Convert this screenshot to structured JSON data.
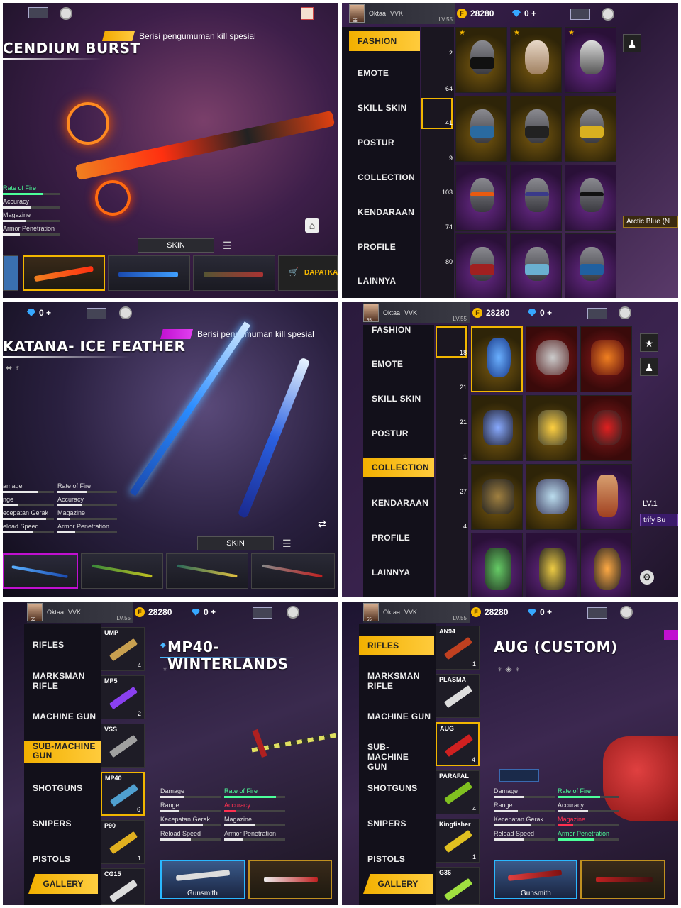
{
  "profile": {
    "name": "Oktaa",
    "guild": "VVK",
    "level": "LV.55",
    "avatar_badge": "55",
    "coins": "28280",
    "diamonds": "0 +"
  },
  "panel1": {
    "title": "CENDIUM BURST",
    "announce": "Berisi pengumuman kill spesial",
    "stats": [
      "Rate of Fire",
      "Accuracy",
      "Magazine",
      "Armor Penetration"
    ],
    "skin_tab": "SKIN",
    "buy_label": "DAPATKAN"
  },
  "panel2": {
    "menu": [
      "FASHION",
      "EMOTE",
      "SKILL SKIN",
      "POSTUR",
      "COLLECTION",
      "KENDARAAN",
      "PROFILE",
      "LAINNYA"
    ],
    "counts": [
      "2",
      "64",
      "41",
      "9",
      "103",
      "74",
      "80"
    ],
    "chip": "Arctic Blue (N"
  },
  "panel3": {
    "title": "KATANA- ICE FEATHER",
    "announce": "Berisi pengumuman kill spesial",
    "stats_left": [
      "amage",
      "nge",
      "ecepatan Gerak",
      "eload Speed"
    ],
    "stats_right": [
      "Rate of Fire",
      "Accuracy",
      "Magazine",
      "Armor Penetration"
    ],
    "skin_tab": "SKIN"
  },
  "panel4": {
    "menu": [
      "FASHION",
      "EMOTE",
      "SKILL SKIN",
      "POSTUR",
      "COLLECTION",
      "KENDARAAN",
      "PROFILE",
      "LAINNYA"
    ],
    "counts": [
      "18",
      "21",
      "21",
      "1",
      "27",
      "4"
    ],
    "level_chip": "LV.1",
    "tip_chip": "trify Bu"
  },
  "panel5": {
    "menu": [
      "RIFLES",
      "MARKSMAN RIFLE",
      "MACHINE GUN",
      "SUB-MACHINE GUN",
      "SHOTGUNS",
      "SNIPERS",
      "PISTOLS"
    ],
    "list": [
      {
        "name": "UMP",
        "count": "4"
      },
      {
        "name": "MP5",
        "count": "2"
      },
      {
        "name": "VSS",
        "count": ""
      },
      {
        "name": "MP40",
        "count": "6"
      },
      {
        "name": "P90",
        "count": "1"
      },
      {
        "name": "CG15",
        "count": ""
      }
    ],
    "title": "MP40-WINTERLANDS",
    "stats_left": [
      "Damage",
      "Range",
      "Kecepatan Gerak",
      "Reload Speed"
    ],
    "stats_right": [
      "Rate of Fire",
      "Accuracy",
      "Magazine",
      "Armor Penetration"
    ],
    "gallery": "GALLERY",
    "gunsmith": "Gunsmith"
  },
  "panel6": {
    "menu": [
      "RIFLES",
      "MARKSMAN RIFLE",
      "MACHINE GUN",
      "SUB-MACHINE GUN",
      "SHOTGUNS",
      "SNIPERS",
      "PISTOLS"
    ],
    "list": [
      {
        "name": "AN94",
        "count": "1"
      },
      {
        "name": "PLASMA",
        "count": ""
      },
      {
        "name": "AUG",
        "count": "4"
      },
      {
        "name": "PARAFAL",
        "count": "4"
      },
      {
        "name": "Kingfisher",
        "count": "1"
      },
      {
        "name": "G36",
        "count": ""
      }
    ],
    "title": "AUG (CUSTOM)",
    "stats_left": [
      "Damage",
      "Range",
      "Kecepatan Gerak",
      "Reload Speed"
    ],
    "stats_right": [
      "Rate of Fire",
      "Accuracy",
      "Magazine",
      "Armor Penetration"
    ],
    "gallery": "GALLERY",
    "gunsmith": "Gunsmith"
  },
  "colors": {
    "accent_gold": "#f2b600",
    "accent_pink": "#e040f0",
    "accent_blue": "#2ab8ff",
    "stat_green": "#4cff9a",
    "stat_red": "#ff3050"
  }
}
